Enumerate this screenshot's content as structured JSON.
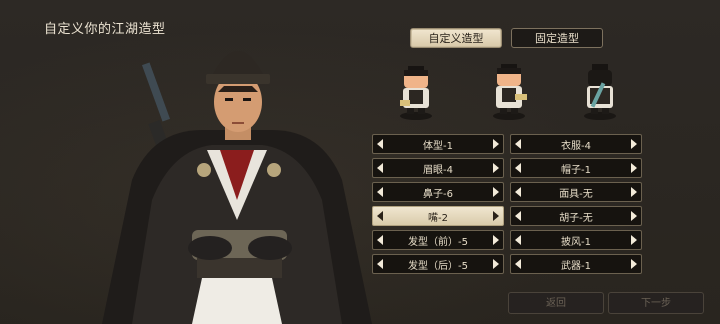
{
  "header": {
    "title": "自定义你的江湖造型"
  },
  "mode_tabs": [
    {
      "label": "自定义造型",
      "active": true
    },
    {
      "label": "固定造型",
      "active": false
    }
  ],
  "preview": {
    "sprites": [
      "character-sprite-front-icon",
      "character-sprite-side-icon",
      "character-sprite-back-icon"
    ]
  },
  "selectors_left": [
    {
      "label": "体型-1"
    },
    {
      "label": "眉眼-4"
    },
    {
      "label": "鼻子-6"
    },
    {
      "label": "嘴-2",
      "selected": true
    },
    {
      "label": "发型（前）-5"
    },
    {
      "label": "发型（后）-5"
    }
  ],
  "selectors_right": [
    {
      "label": "衣服-4"
    },
    {
      "label": "帽子-1"
    },
    {
      "label": "面具-无"
    },
    {
      "label": "胡子-无"
    },
    {
      "label": "披风-1"
    },
    {
      "label": "武器-1"
    }
  ],
  "footer": {
    "back_label": "返回",
    "next_label": "下一步"
  },
  "colors": {
    "background": "#2a2622",
    "selected_fill": "#e9ddc1",
    "row_fill": "#16130f",
    "row_border": "#6b614f"
  }
}
